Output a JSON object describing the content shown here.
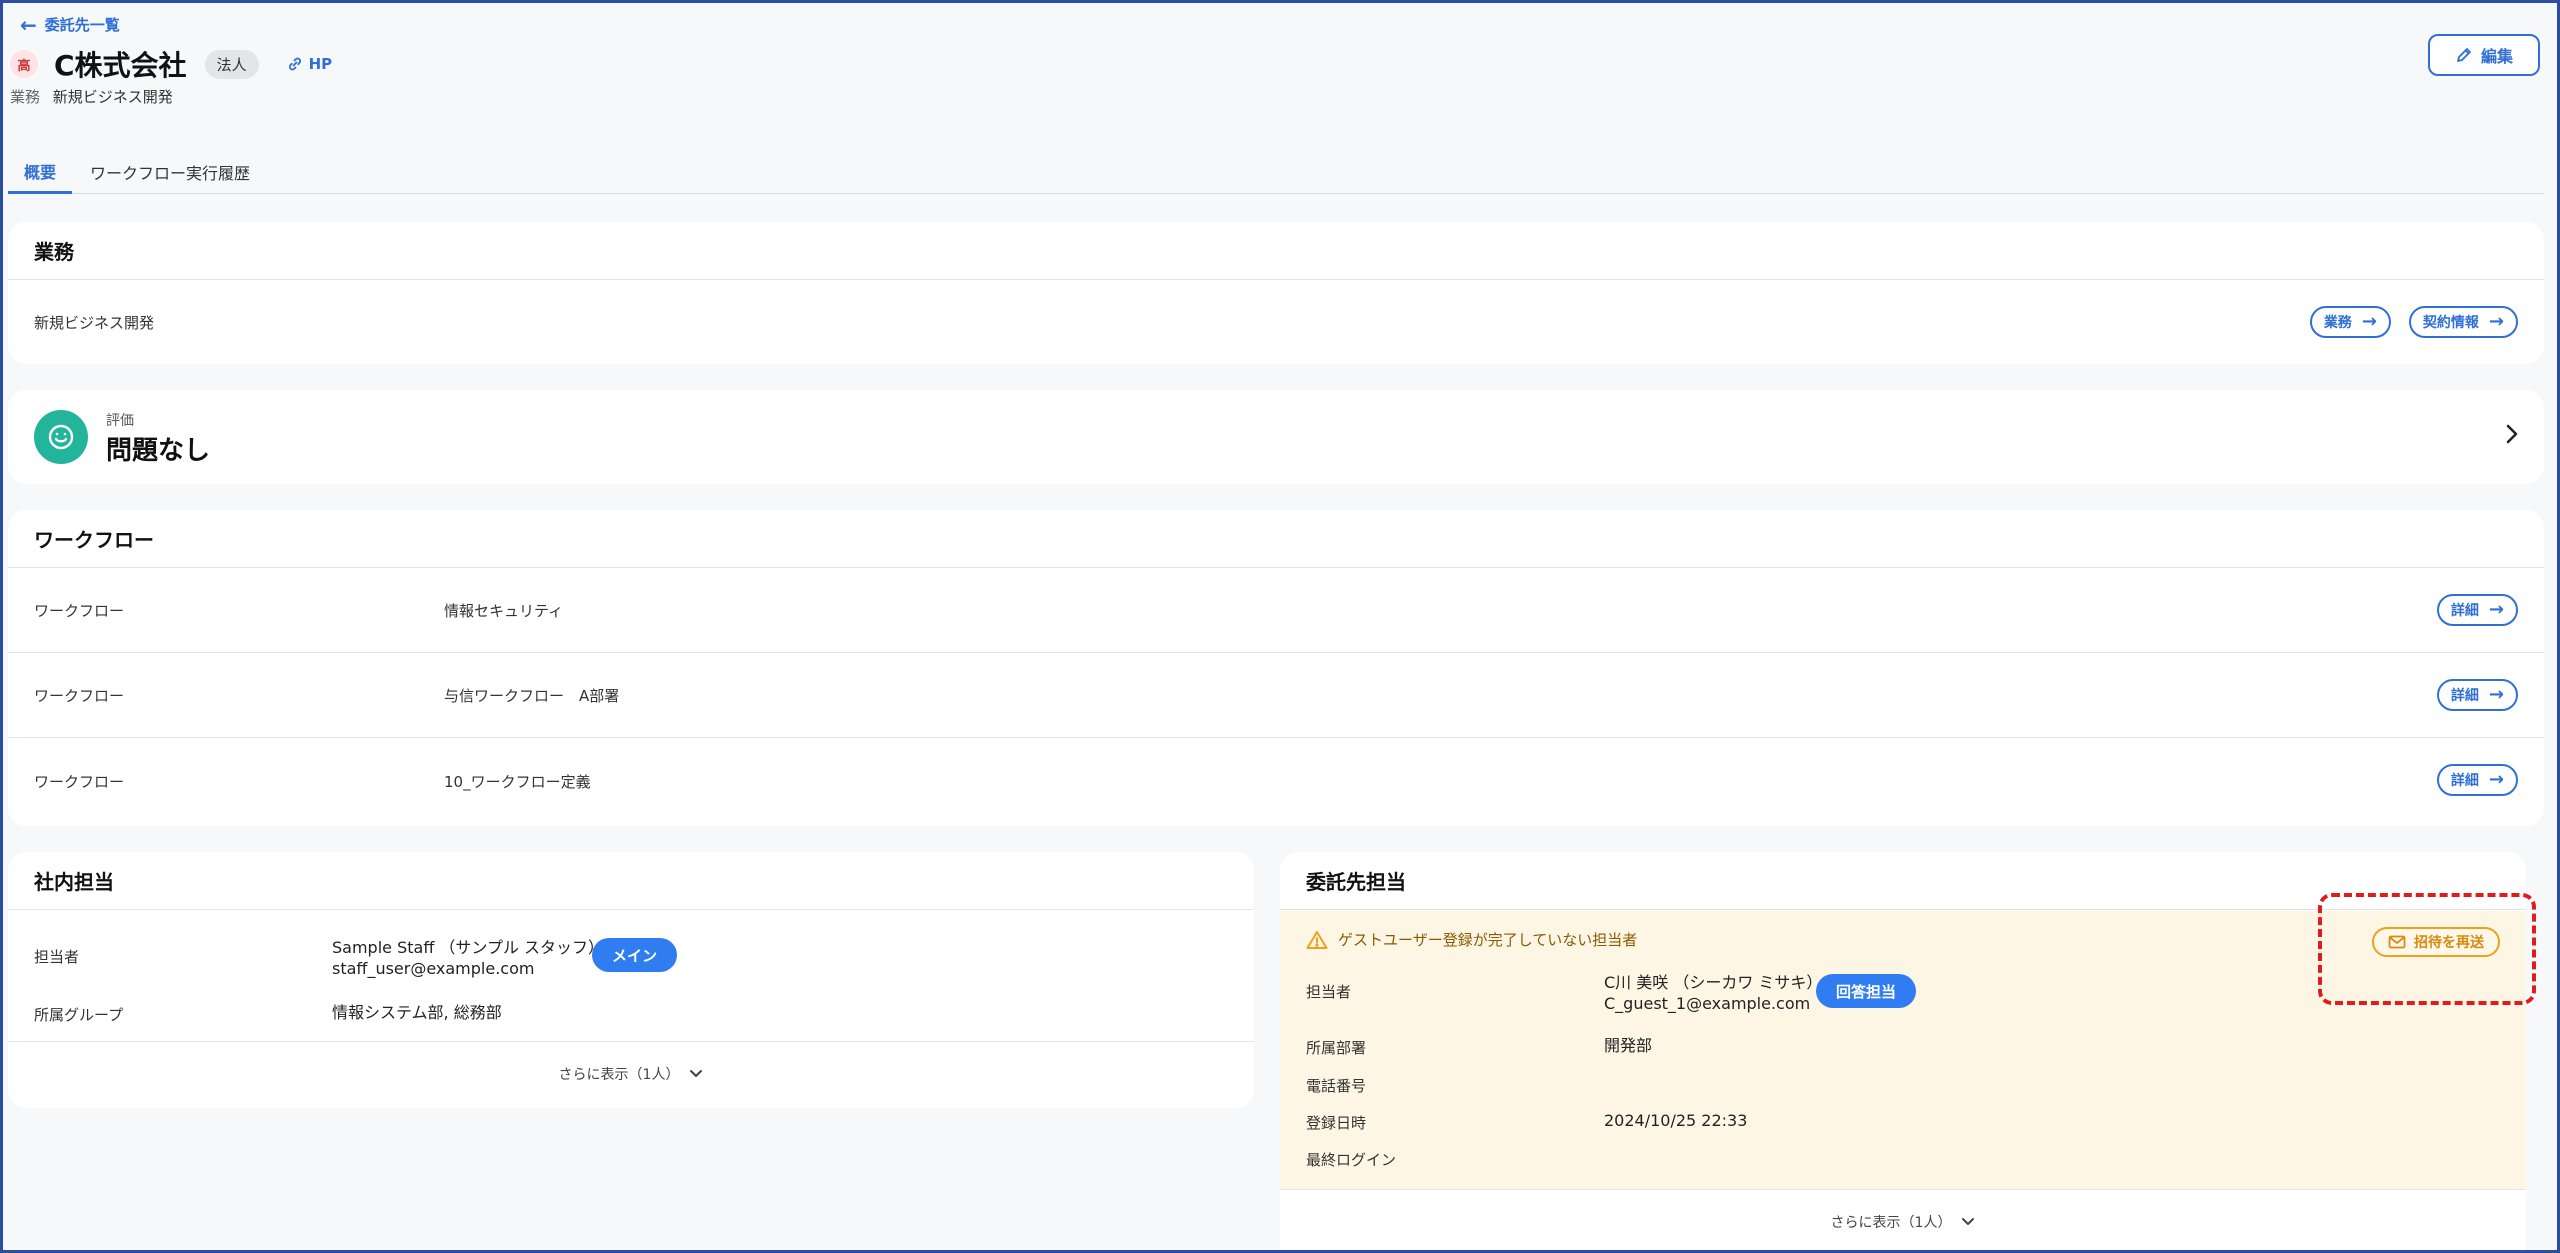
{
  "header": {
    "back_label": "委託先一覧",
    "priority_badge": "高",
    "company_name": "C株式会社",
    "entity_type": "法人",
    "hp_label": "HP",
    "business_label": "業務",
    "business_value": "新規ビジネス開発",
    "edit_label": "編集"
  },
  "tabs": [
    {
      "label": "概要",
      "active": true
    },
    {
      "label": "ワークフロー実行履歴",
      "active": false
    }
  ],
  "business_card": {
    "title": "業務",
    "value": "新規ビジネス開発",
    "business_btn": "業務",
    "contract_btn": "契約情報"
  },
  "evaluation": {
    "label": "評価",
    "value": "問題なし"
  },
  "workflow_card": {
    "title": "ワークフロー",
    "rows": [
      {
        "label": "ワークフロー",
        "name": "情報セキュリティ",
        "btn": "詳細"
      },
      {
        "label": "ワークフロー",
        "name": "与信ワークフロー　A部署",
        "btn": "詳細"
      },
      {
        "label": "ワークフロー",
        "name": "10_ワークフロー定義",
        "btn": "詳細"
      }
    ]
  },
  "internal_card": {
    "title": "社内担当",
    "person_label": "担当者",
    "person_name": "Sample Staff （サンプル スタッフ）",
    "person_email": "staff_user@example.com",
    "main_badge": "メイン",
    "group_label": "所属グループ",
    "group_value": "情報システム部, 総務部",
    "more_label": "さらに表示（1人）"
  },
  "vendor_card": {
    "title": "委託先担当",
    "warning": "ゲストユーザー登録が完了していない担当者",
    "resend_label": "招待を再送",
    "person_label": "担当者",
    "person_name": "C川 美咲 （シーカワ ミサキ）",
    "person_email": "C_guest_1@example.com",
    "answer_badge": "回答担当",
    "dept_label": "所属部署",
    "dept_value": "開発部",
    "phone_label": "電話番号",
    "phone_value": "",
    "registered_label": "登録日時",
    "registered_value": "2024/10/25 22:33",
    "last_login_label": "最終ログイン",
    "last_login_value": "",
    "more_label": "さらに表示（1人）"
  },
  "colors": {
    "accent": "#2f6fd6",
    "eval_green": "#22b59c",
    "warning_bg": "#fdf6e5",
    "warning_orange": "#f0a020",
    "highlight_red": "#e01c1c"
  }
}
